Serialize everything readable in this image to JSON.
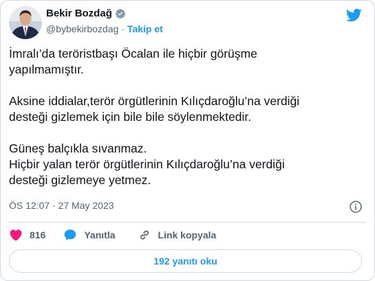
{
  "author": {
    "name": "Bekir Bozdağ",
    "handle": "@bybekirbozdag",
    "separator": "·",
    "follow_label": "Takip et"
  },
  "tweet": {
    "paragraphs": [
      "İmralı’da teröristbaşı Öcalan ile hiçbir görüşme\nyapılmamıştır.",
      "Aksine iddialar,terör örgütlerinin Kılıçdaroğlu’na verdiği\ndesteği gizlemek için bile bile söylenmektedir.",
      "Güneş balçıkla sıvanmaz.\nHiçbir yalan terör örgütlerinin Kılıçdaroğlu’na verdiği\ndesteği gizlemeye yetmez."
    ],
    "timestamp": "ÖS 12:07 · 27 May 2023"
  },
  "actions": {
    "like_count": "816",
    "reply_label": "Yanıtla",
    "copy_link_label": "Link kopyala",
    "read_replies_label": "192 yanıtı oku"
  },
  "colors": {
    "accent": "#1d9bf0",
    "like": "#f91880",
    "secondary_text": "#536471",
    "border": "#cfd9de"
  },
  "icons": {
    "brand": "twitter-bird-icon",
    "verified": "verified-badge-icon",
    "info": "info-icon",
    "like": "heart-icon",
    "reply": "speech-bubble-icon",
    "copy_link": "link-icon"
  }
}
